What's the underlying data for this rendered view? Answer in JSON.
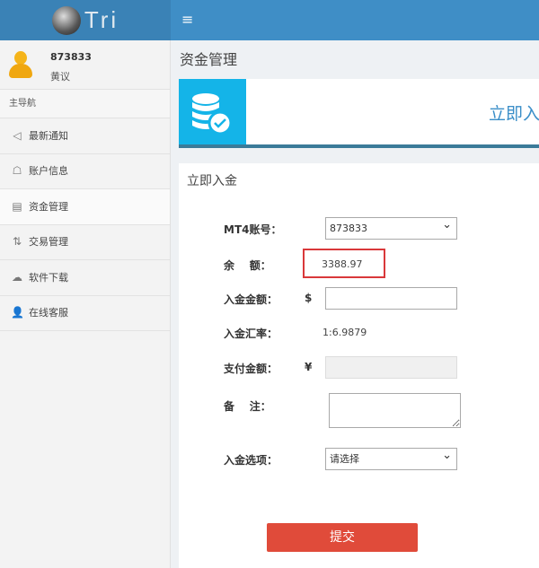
{
  "header": {
    "logo_text": "Tri",
    "menu_icon": "hamburger-icon"
  },
  "user": {
    "id": "873833",
    "name": "黄议"
  },
  "sidebar": {
    "heading": "主导航",
    "items": [
      {
        "label": "最新通知",
        "icon": "speaker-icon"
      },
      {
        "label": "账户信息",
        "icon": "user-card-icon"
      },
      {
        "label": "资金管理",
        "icon": "money-icon",
        "active": true
      },
      {
        "label": "交易管理",
        "icon": "trade-icon"
      },
      {
        "label": "软件下载",
        "icon": "cloud-download-icon"
      },
      {
        "label": "在线客服",
        "icon": "person-icon"
      }
    ]
  },
  "page": {
    "title": "资金管理",
    "panel_text": "立即入",
    "form_title": "立即入金"
  },
  "form": {
    "account_label": "MT4账号：",
    "account_value": "873833",
    "balance_label": "余    额：",
    "balance_value": "3388.97",
    "amount_label": "入金金额：",
    "amount_currency": "$",
    "amount_value": "",
    "rate_label": "入金汇率：",
    "rate_value": "1:6.9879",
    "pay_label": "支付金额：",
    "pay_currency": "¥",
    "pay_value": "",
    "note_label": "备    注：",
    "note_value": "",
    "option_label": "入金选项：",
    "option_value": "请选择",
    "submit": "提交"
  },
  "colors": {
    "header": "#3f8ec6",
    "accent": "#14b4e8",
    "submit": "#e04b3a",
    "highlight": "#d9383a"
  }
}
